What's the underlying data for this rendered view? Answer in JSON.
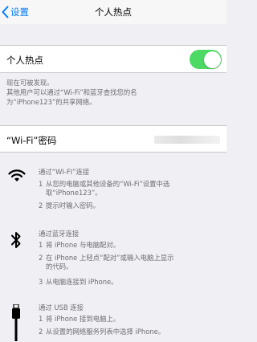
{
  "navbar": {
    "back_label": "设置",
    "title": "个人热点"
  },
  "hotspot": {
    "label": "个人热点",
    "enabled": true,
    "accent_color": "#4cd964"
  },
  "discovery": {
    "line1": "现在可被发现。",
    "line2": "其他用户可以通过“Wi-Fi”和蓝牙查找您的名",
    "line3": "为“iPhone123”的共享网络。"
  },
  "wifi_password": {
    "label": "“Wi-Fi”密码"
  },
  "sections": {
    "wifi": {
      "icon": "wifi-icon",
      "title": "通过“WI-FI”连接",
      "step1_num": "1",
      "step1_line1": "从您的电脑或其他设备的“Wi-Fi”设置中选",
      "step1_line2": "取“iPhone123”。",
      "step2_num": "2",
      "step2": "提示时输入密码。"
    },
    "bluetooth": {
      "icon": "bluetooth-icon",
      "title": "通过蓝牙连接",
      "step1_num": "1",
      "step1": "将 iPhone 与电脑配对。",
      "step2_num": "2",
      "step2_line1": "在 iPhone 上轻点“配对”或输入电脑上显示",
      "step2_line2": "的代码。",
      "step3_num": "3",
      "step3": "从电脑连接到 iPhone。"
    },
    "usb": {
      "icon": "usb-cable-icon",
      "title": "通过 USB 连接",
      "step1_num": "1",
      "step1": "将 iPhone 接到电脑上。",
      "step2_num": "2",
      "step2": "从设置的网络服务列表中选择 iPhone。"
    }
  }
}
